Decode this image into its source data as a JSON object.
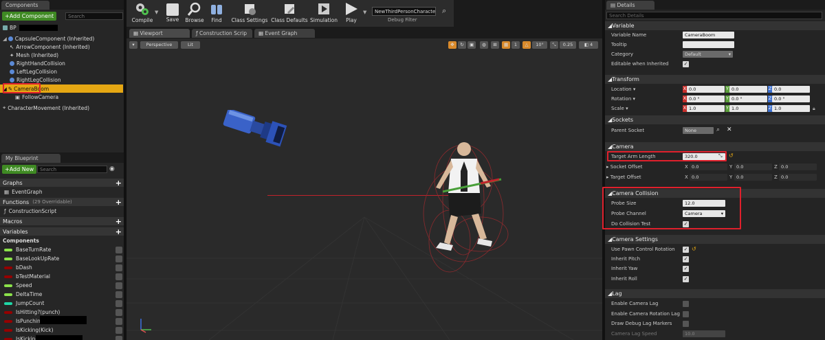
{
  "components": {
    "tab": "Components",
    "add_label": "+Add Component",
    "search_placeholder": "Search",
    "root": "BP",
    "items": [
      "CapsuleComponent (Inherited)",
      "ArrowComponent (Inherited)",
      "Mesh (Inherited)",
      "RightHandCollision",
      "LeftLegCollision",
      "RightLegCollision",
      "CameraBoom",
      "FollowCamera",
      "CharacterMovement (Inherited)"
    ]
  },
  "blueprint": {
    "tab": "My Blueprint",
    "add_label": "+Add New",
    "search_placeholder": "Search",
    "graphs": "Graphs",
    "event_graph": "EventGraph",
    "functions": "Functions",
    "functions_note": "(29 Overridable)",
    "construction": "ConstructionScript",
    "macros": "Macros",
    "variables": "Variables",
    "components_label": "Components",
    "vars": [
      {
        "name": "BaseTurnRate",
        "color": "#8be24a"
      },
      {
        "name": "BaseLookUpRate",
        "color": "#8be24a"
      },
      {
        "name": "bDash",
        "color": "#950000"
      },
      {
        "name": "bTestMaterial",
        "color": "#950000"
      },
      {
        "name": "Speed",
        "color": "#8be24a"
      },
      {
        "name": "DeltaTime",
        "color": "#8be24a"
      },
      {
        "name": "JumpCount",
        "color": "#1fd7a6"
      },
      {
        "name": "IsHitting?(punch)",
        "color": "#950000"
      },
      {
        "name": "IsPunching",
        "color": "#950000"
      },
      {
        "name": "IsKicking(Kick)",
        "color": "#950000"
      },
      {
        "name": "IsKicking",
        "color": "#950000"
      }
    ]
  },
  "toolbar": {
    "compile": "Compile",
    "save": "Save",
    "browse": "Browse",
    "find": "Find",
    "class_settings": "Class Settings",
    "class_defaults": "Class Defaults",
    "simulation": "Simulation",
    "play": "Play",
    "debug_object": "NewThirdPersonCharacter",
    "debug_filter": "Debug Filter"
  },
  "editor_tabs": [
    "Viewport",
    "Construction Scrip",
    "Event Graph"
  ],
  "viewport": {
    "perspective": "Perspective",
    "lit": "Lit",
    "angle_snap": "10°",
    "scale_snap": "0.25",
    "camera_speed": "4"
  },
  "details": {
    "tab": "Details",
    "search_placeholder": "Search Details",
    "variable": {
      "title": "Variable",
      "variable_name_label": "Variable Name",
      "variable_name": "CameraBoom",
      "tooltip_label": "Tooltip",
      "category_label": "Category",
      "category": "Default",
      "editable_label": "Editable when Inherited"
    },
    "transform": {
      "title": "Transform",
      "location_label": "Location",
      "rotation_label": "Rotation",
      "scale_label": "Scale",
      "location": [
        "0.0",
        "0.0",
        "0.0"
      ],
      "rotation": [
        "0.0 °",
        "0.0 °",
        "0.0 °"
      ],
      "scale": [
        "1.0",
        "1.0",
        "1.0"
      ]
    },
    "sockets": {
      "title": "Sockets",
      "parent_label": "Parent Socket",
      "parent_value": "None"
    },
    "camera": {
      "title": "Camera",
      "arm_label": "Target Arm Length",
      "arm_value": "320.0",
      "socket_offset_label": "Socket Offset",
      "target_offset_label": "Target Offset",
      "socket_offset": [
        "0.0",
        "0.0",
        "0.0"
      ],
      "target_offset": [
        "0.0",
        "0.0",
        "0.0"
      ]
    },
    "collision": {
      "title": "Camera Collision",
      "probe_size_label": "Probe Size",
      "probe_size": "12.0",
      "probe_channel_label": "Probe Channel",
      "probe_channel": "Camera",
      "do_collision_label": "Do Collision Test"
    },
    "settings": {
      "title": "Camera Settings",
      "pawn_label": "Use Pawn Control Rotation",
      "pitch_label": "Inherit Pitch",
      "yaw_label": "Inherit Yaw",
      "roll_label": "Inherit Roll"
    },
    "lag": {
      "title": "Lag",
      "cam_lag_label": "Enable Camera Lag",
      "rot_lag_label": "Enable Camera Rotation Lag",
      "debug_label": "Draw Debug Lag Markers",
      "speed_label": "Camera Lag Speed",
      "speed_value": "10.0"
    },
    "axes": {
      "x": "X",
      "y": "Y",
      "z": "Z"
    }
  }
}
